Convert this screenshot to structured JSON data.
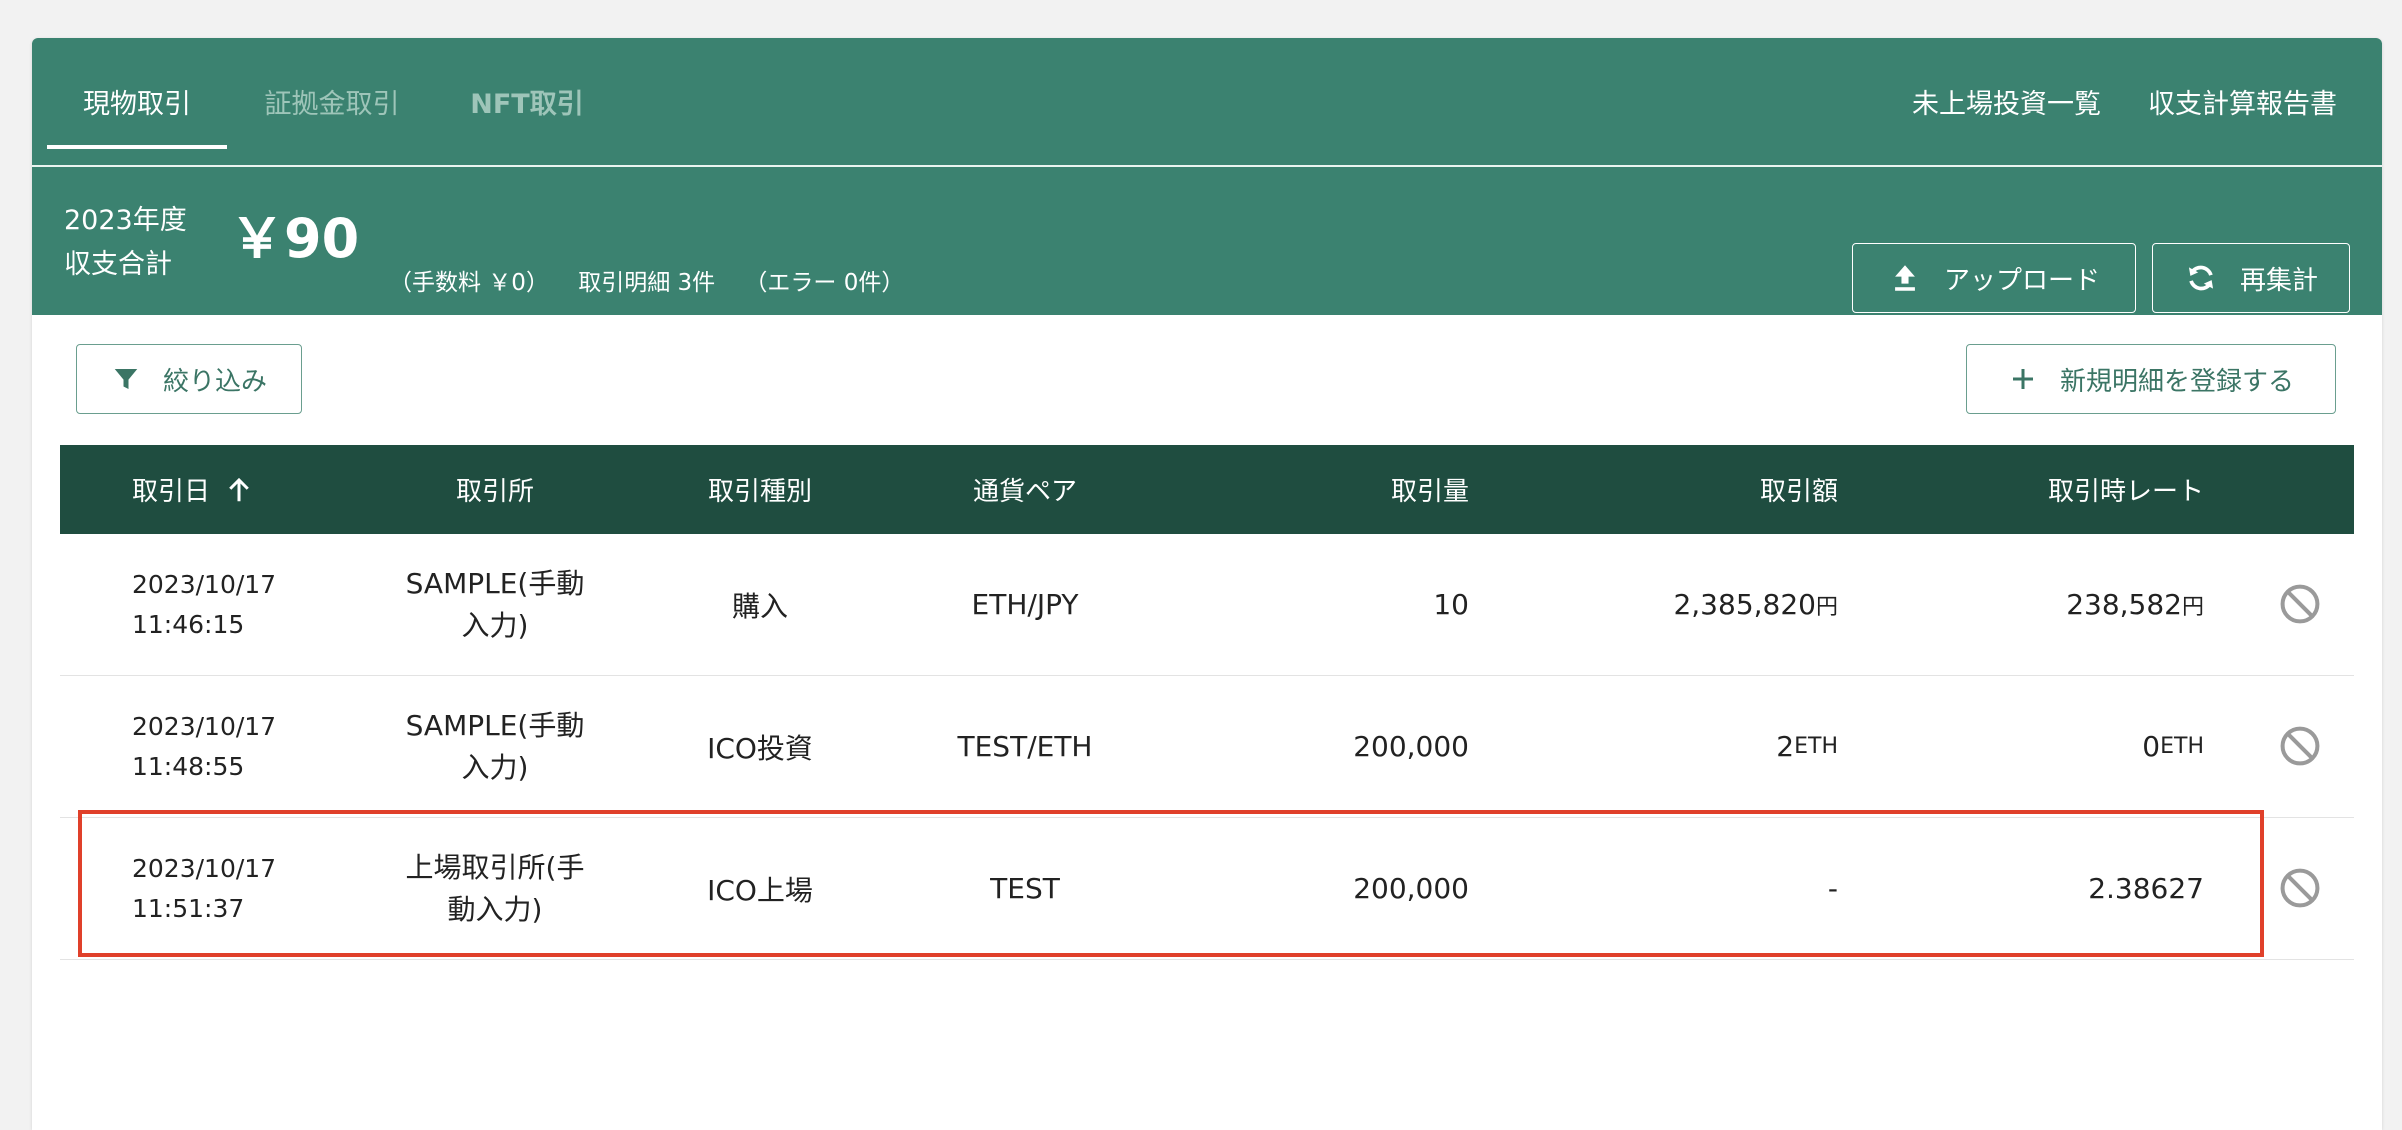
{
  "tabs": [
    {
      "label": "現物取引",
      "active": true
    },
    {
      "label": "証拠金取引",
      "active": false
    },
    {
      "label": "NFT取引",
      "active": false
    }
  ],
  "nav_links": [
    "未上場投資一覧",
    "収支計算報告書"
  ],
  "summary": {
    "fiscal_year": "2023年度",
    "total_label": "収支合計",
    "total_value": "￥90",
    "fee": "（手数料 ￥0）",
    "detail_count": "取引明細 3件",
    "error_count": "（エラー 0件）"
  },
  "buttons": {
    "upload": "アップロード",
    "recalc": "再集計",
    "filter": "絞り込み",
    "add_new": "新規明細を登録する"
  },
  "table": {
    "headers": [
      "取引日",
      "取引所",
      "取引種別",
      "通貨ペア",
      "取引量",
      "取引額",
      "取引時レート"
    ],
    "sort": {
      "column": "取引日",
      "direction": "asc"
    },
    "rows": [
      {
        "date": "2023/10/17",
        "time": "11:46:15",
        "exchange_l1": "SAMPLE(手動",
        "exchange_l2": "入力)",
        "type": "購入",
        "pair": "ETH/JPY",
        "amount": "10",
        "value": "2,385,820",
        "value_unit": "円",
        "rate": "238,582",
        "rate_unit": "円"
      },
      {
        "date": "2023/10/17",
        "time": "11:48:55",
        "exchange_l1": "SAMPLE(手動",
        "exchange_l2": "入力)",
        "type": "ICO投資",
        "pair": "TEST/ETH",
        "amount": "200,000",
        "value": "2",
        "value_unit": "ETH",
        "rate": "0",
        "rate_unit": "ETH"
      },
      {
        "date": "2023/10/17",
        "time": "11:51:37",
        "exchange_l1": "上場取引所(手",
        "exchange_l2": "動入力)",
        "type": "ICO上場",
        "pair": "TEST",
        "amount": "200,000",
        "value": "-",
        "value_unit": "",
        "rate": "2.38627",
        "rate_unit": ""
      }
    ]
  },
  "colors": {
    "header_green": "#3b8270",
    "table_header": "#1f4d40",
    "highlight": "#e0402a"
  }
}
